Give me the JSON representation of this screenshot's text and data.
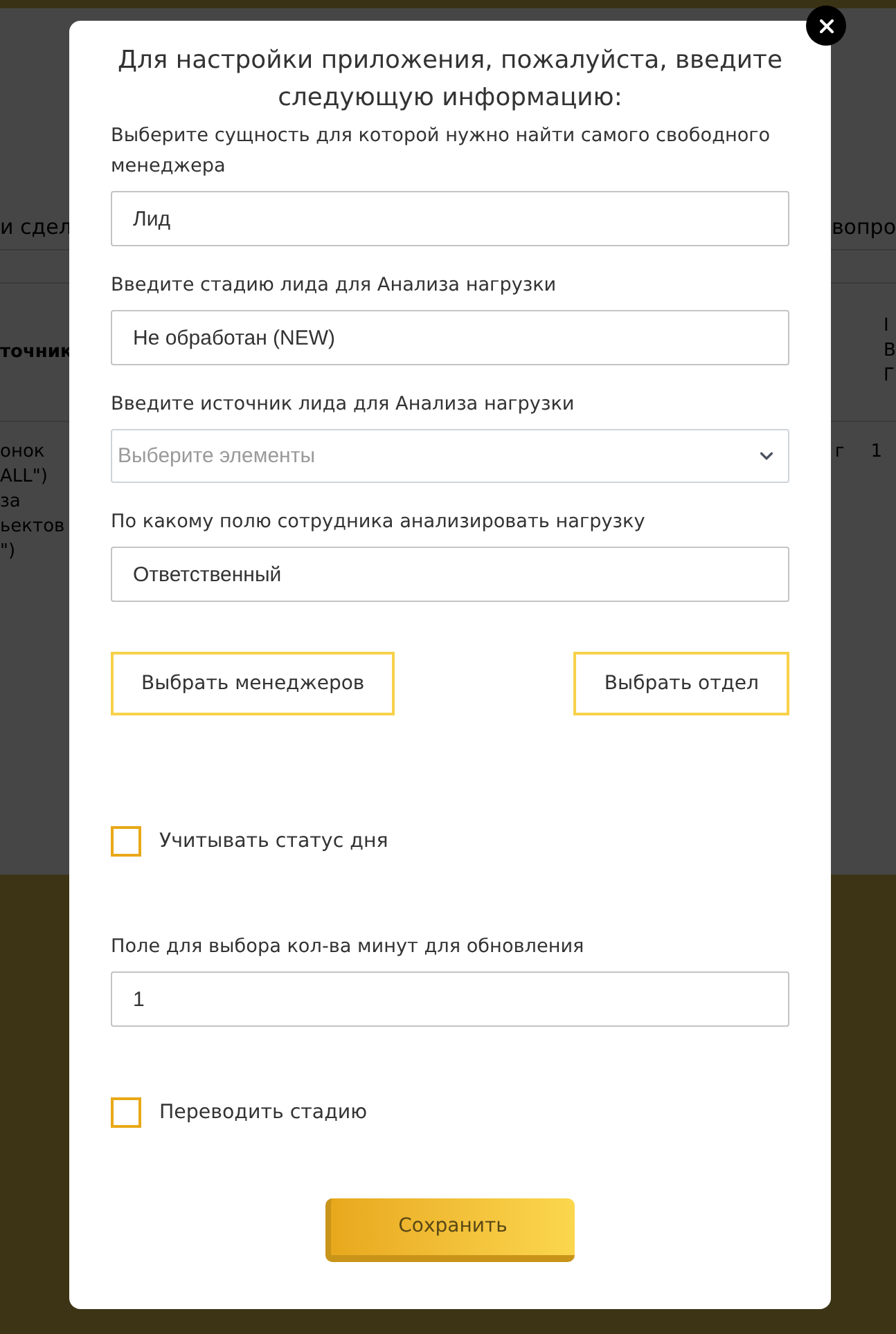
{
  "background": {
    "nav_items": [
      "и сдел",
      "вопро"
    ],
    "table": {
      "header": [
        "точник",
        "I\nВ\nГ"
      ],
      "rows": [
        [
          "онок\nALL\")\nза\nьектов\n\")",
          "г",
          "1"
        ]
      ]
    }
  },
  "dialog": {
    "title": "Для настройки приложения, пожалуйста, введите следующую информацию:",
    "fields": [
      {
        "kind": "text",
        "label": "Выберите сущность для которой нужно найти самого свободного менеджера",
        "value": "Лид"
      },
      {
        "kind": "text",
        "label": "Введите стадию лида для Анализа нагрузки",
        "value": "Не обработан (NEW)"
      },
      {
        "kind": "select",
        "label": "Введите источник лида для Анализа нагрузки",
        "placeholder": "Выберите элементы"
      },
      {
        "kind": "text",
        "label": "По какому полю сотрудника анализировать нагрузку",
        "value": "Ответственный"
      }
    ],
    "buttons": [
      "Выбрать менеджеров",
      "Выбрать отдел"
    ],
    "options": [
      {
        "kind": "checkbox",
        "label": "Учитывать статус дня",
        "checked": false
      },
      {
        "kind": "text",
        "label": "Поле для выбора кол-ва минут для обновления",
        "value": "1"
      },
      {
        "kind": "checkbox",
        "label": "Переводить стадию",
        "checked": false
      }
    ],
    "save_button": "Сохранить"
  }
}
